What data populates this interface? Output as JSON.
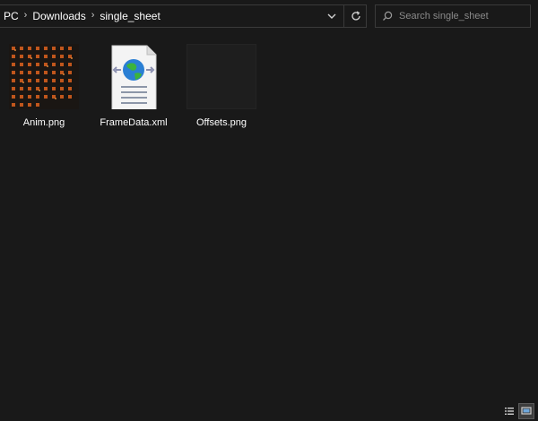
{
  "breadcrumb": {
    "items": [
      {
        "label": "PC"
      },
      {
        "label": "Downloads"
      },
      {
        "label": "single_sheet"
      }
    ]
  },
  "search": {
    "placeholder": "Search single_sheet"
  },
  "files": [
    {
      "name": "Anim.png",
      "icon": "image-thumbnail-sprite-sheet"
    },
    {
      "name": "FrameData.xml",
      "icon": "xml-document-globe-icon"
    },
    {
      "name": "Offsets.png",
      "icon": "image-thumbnail-dark"
    }
  ],
  "statusbar": {
    "views": [
      "details-view",
      "large-icons-view"
    ],
    "active_view": "large-icons-view"
  },
  "colors": {
    "background": "#191919",
    "border": "#3a3a3a",
    "text": "#ffffff",
    "placeholder": "#8a8a8a",
    "sprite": "#c0561c"
  }
}
